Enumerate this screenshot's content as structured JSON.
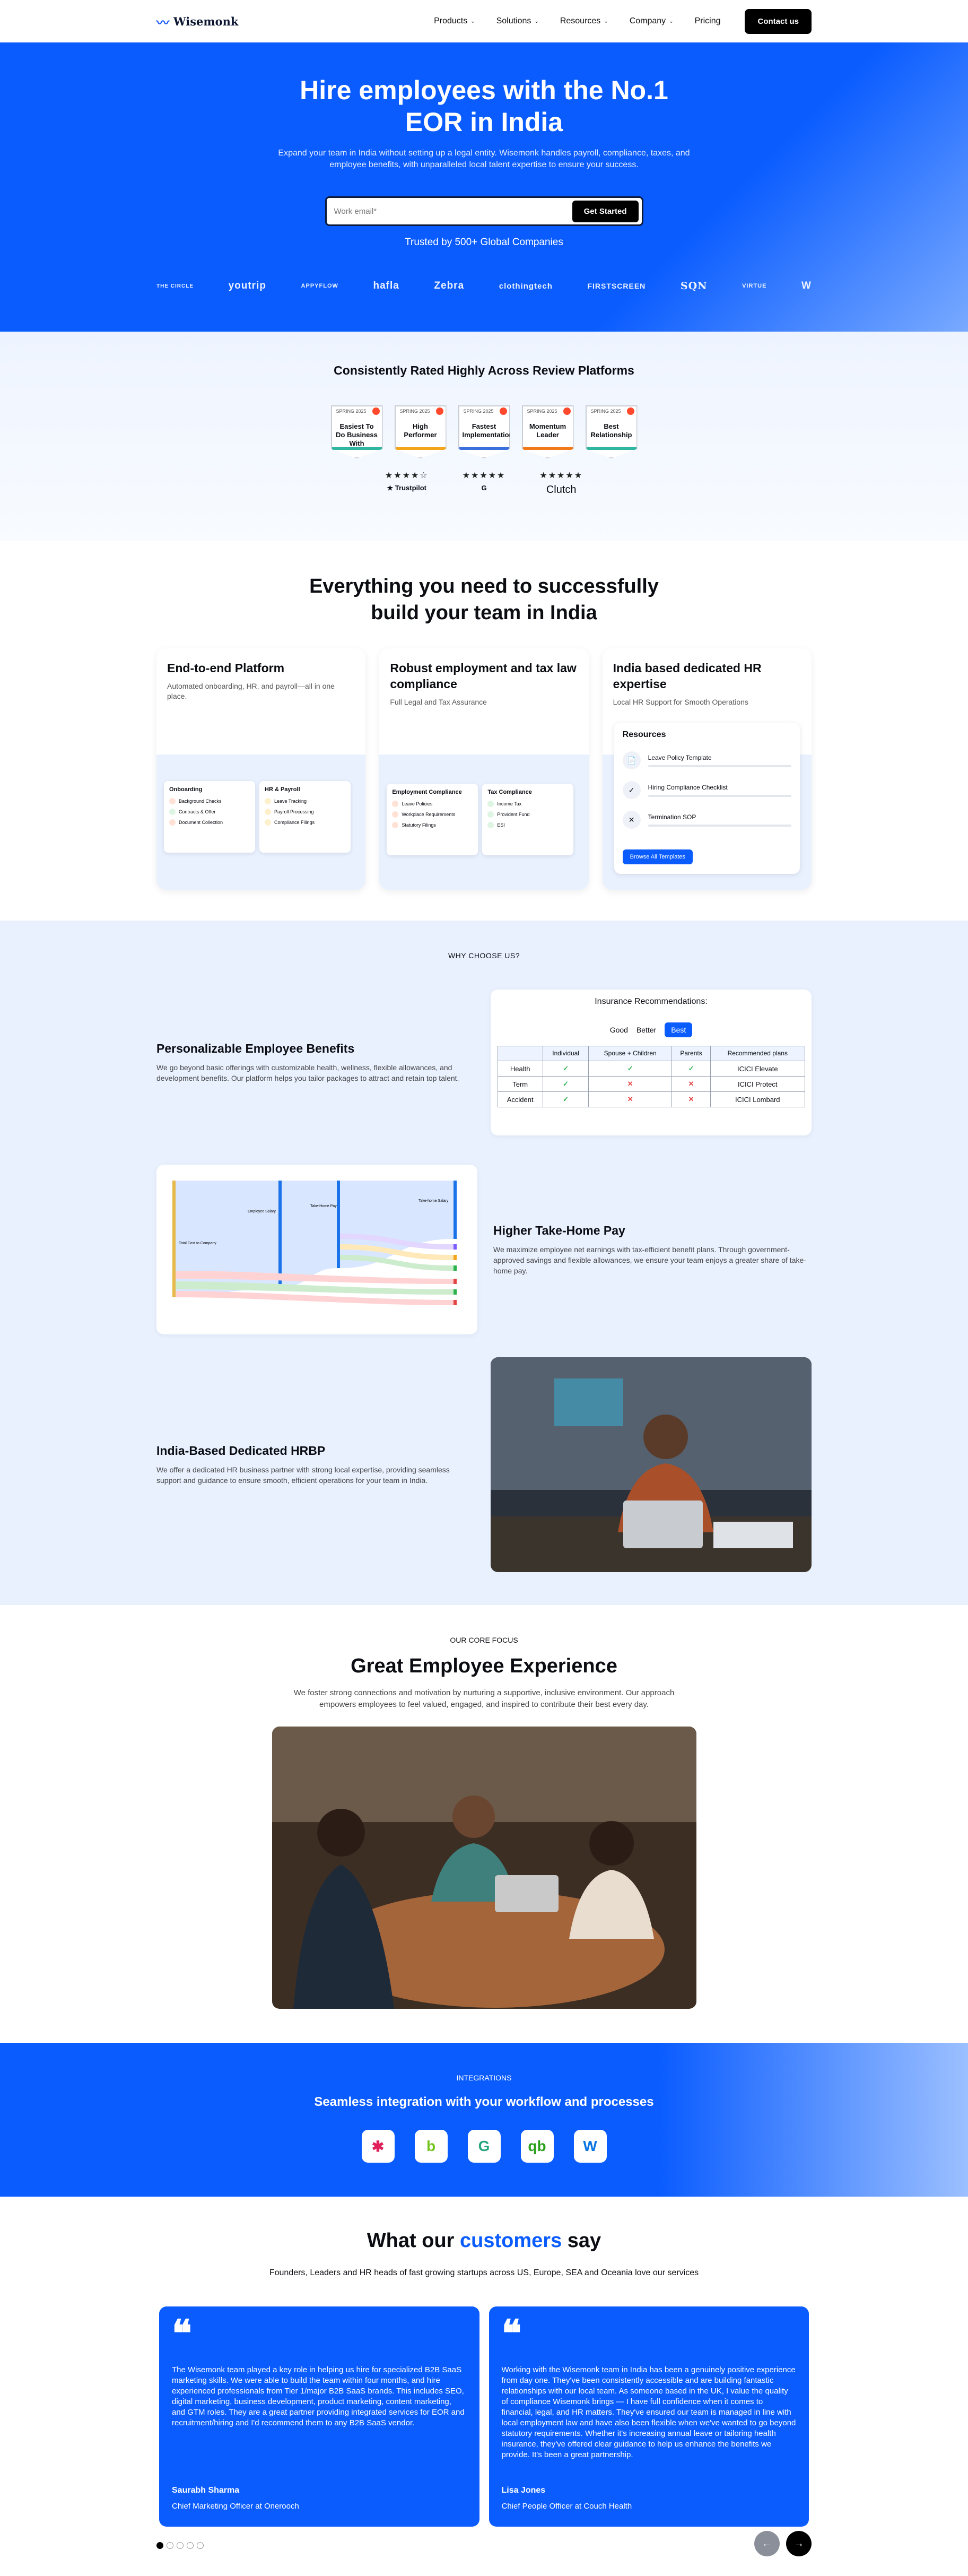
{
  "nav": {
    "brand": "Wisemonk",
    "menu": [
      "Products",
      "Solutions",
      "Resources",
      "Company",
      "Pricing"
    ],
    "cta": "Contact us"
  },
  "hero": {
    "title": "Hire employees with the No.1 EOR in India",
    "subtitle": "Expand your team in India without setting up a legal entity. Wisemonk handles payroll, compliance, taxes, and employee benefits, with unparalleled local talent expertise to ensure your success.",
    "email_placeholder": "Work email*",
    "button": "Get Started",
    "trusted": "Trusted by 500+ Global Companies",
    "logos": [
      "THE CIRCLE",
      "youtrip",
      "APPYFLOW",
      "hafla",
      "Zebra",
      "clothingtech",
      "FIRSTSCREEN",
      "SQN",
      "VIRTUE",
      "W"
    ]
  },
  "reviews": {
    "title": "Consistently Rated Highly Across Review Platforms",
    "badges": [
      {
        "top": "SPRING 2025",
        "label": "Easiest To Do Business With",
        "color": "#2fb5a0"
      },
      {
        "top": "SPRING 2025",
        "label": "High Performer",
        "color": "#f2a41a"
      },
      {
        "top": "SPRING 2025",
        "label": "Fastest Implementation",
        "color": "#3d6fdc"
      },
      {
        "top": "SPRING 2025",
        "label": "Momentum Leader",
        "color": "#f07a1a"
      },
      {
        "top": "SPRING 2025",
        "label": "Best Relationship",
        "color": "#2fb5a0"
      }
    ],
    "ratings": [
      {
        "stars": "★★★★☆",
        "name": "★ Trustpilot"
      },
      {
        "stars": "★★★★★",
        "name": "G"
      },
      {
        "stars": "★★★★★",
        "name": "Clutch"
      }
    ]
  },
  "features": {
    "title": "Everything you need to successfully build your team in India",
    "cards": [
      {
        "title": "End-to-end Platform",
        "desc": "Automated onboarding, HR, and payroll—all in one place.",
        "panels": [
          {
            "title": "Onboarding",
            "items": [
              "Background Checks",
              "Contracts & Offer",
              "Document Collection"
            ]
          },
          {
            "title": "HR & Payroll",
            "items": [
              "Leave Tracking",
              "Payroll Processing",
              "Compliance Filings"
            ]
          }
        ]
      },
      {
        "title": "Robust employment and tax law compliance",
        "desc": "Full Legal and Tax Assurance",
        "panels": [
          {
            "title": "Employment Compliance",
            "items": [
              "Leave Policies",
              "Workplace Requirements",
              "Statutory Filings"
            ]
          },
          {
            "title": "Tax Compliance",
            "items": [
              "Income Tax",
              "Provident Fund",
              "ESI"
            ]
          }
        ]
      },
      {
        "title": "India based dedicated HR expertise",
        "desc": "Local HR Support for Smooth Operations",
        "resources": {
          "title": "Resources",
          "items": [
            "Leave Policy Template",
            "Hiring Compliance Checklist",
            "Termination SOP"
          ],
          "button": "Browse All Templates"
        }
      }
    ]
  },
  "why": {
    "label": "WHY CHOOSE US?",
    "benefits": {
      "title": "Personalizable Employee Benefits",
      "desc": "We go beyond basic offerings with customizable health, wellness, flexible allowances, and development benefits. Our platform helps you tailor packages to attract and retain top talent."
    },
    "insurance": {
      "title": "Insurance Recommendations:",
      "tabs": [
        "Good",
        "Better",
        "Best"
      ],
      "headers": [
        "",
        "Individual",
        "Spouse + Children",
        "Parents",
        "Recommended plans"
      ],
      "rows": [
        {
          "name": "Health",
          "cells": [
            "✓",
            "✓",
            "✓"
          ],
          "plan": "ICICI Elevate"
        },
        {
          "name": "Term",
          "cells": [
            "✓",
            "✕",
            "✕"
          ],
          "plan": "ICICI Protect"
        },
        {
          "name": "Accident",
          "cells": [
            "✓",
            "✕",
            "✕"
          ],
          "plan": "ICICI Lombard"
        }
      ]
    },
    "takehome": {
      "title": "Higher Take-Home Pay",
      "desc": "We maximize employee net earnings with tax-efficient benefit plans. Through government-approved savings and flexible allowances, we ensure your team enjoys a greater share of take-home pay."
    },
    "sankey_labels": [
      "Total Cost to Company",
      "Employee Salary",
      "Take-Home Pay",
      "Take-home Salary"
    ],
    "hrbp": {
      "title": "India-Based Dedicated HRBP",
      "desc": "We offer a dedicated HR business partner with strong local expertise, providing seamless support and guidance to ensure smooth, efficient operations for your team in India."
    }
  },
  "focus": {
    "label": "OUR CORE FOCUS",
    "title": "Great Employee Experience",
    "desc": "We foster strong connections and motivation by nurturing a supportive, inclusive environment. Our approach empowers employees to feel valued, engaged, and inspired to contribute their best every day."
  },
  "integrations": {
    "label": "INTEGRATIONS",
    "title": "Seamless integration with your workflow and processes",
    "icons": [
      {
        "name": "slack-icon",
        "glyph": "✱",
        "color": "#e01e5a"
      },
      {
        "name": "bamboohr-icon",
        "glyph": "b",
        "color": "#73c41d"
      },
      {
        "name": "greenhouse-icon",
        "glyph": "G",
        "color": "#24a47f"
      },
      {
        "name": "quickbooks-icon",
        "glyph": "qb",
        "color": "#2ca01c"
      },
      {
        "name": "workday-icon",
        "glyph": "W",
        "color": "#0875e1"
      }
    ]
  },
  "testimonials": {
    "title_pre": "What our ",
    "title_hl": "customers",
    "title_post": " say",
    "sub": "Founders, Leaders and HR heads of fast growing startups across US, Europe, SEA and Oceania love our services",
    "cards": [
      {
        "body": "The Wisemonk team played a key role in helping us hire for specialized B2B SaaS marketing skills. We were able to build the team within four months, and hire experienced professionals from Tier 1/major B2B SaaS brands. This includes SEO, digital marketing, business development, product marketing, content marketing, and GTM roles. They are a great partner providing integrated services for EOR and recruitment/hiring and I'd recommend them to any B2B SaaS vendor.",
        "name": "Saurabh Sharma",
        "role": "Chief Marketing Officer at Onerooch"
      },
      {
        "body": "Working with the Wisemonk team in India has been a genuinely positive experience from day one. They've been consistently accessible and are building fantastic relationships with our local team. As someone based in the UK, I value the quality of compliance Wisemonk brings — I have full confidence when it comes to financial, legal, and HR matters. They've ensured our team is managed in line with local employment law and have also been flexible when we've wanted to go beyond statutory requirements. Whether it's increasing annual leave or tailoring health insurance, they've offered clear guidance to help us enhance the benefits we provide. It's been a great partnership.",
        "name": "Lisa Jones",
        "role": "Chief People Officer at Couch Health"
      }
    ],
    "prev": "←",
    "next": "→"
  }
}
